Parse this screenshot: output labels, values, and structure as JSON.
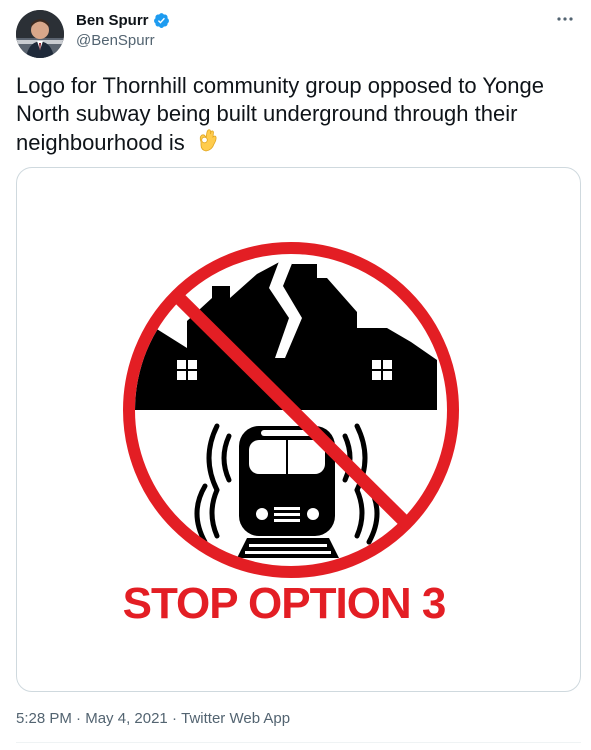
{
  "author": {
    "name": "Ben Spurr",
    "handle": "@BenSpurr",
    "verified": true,
    "verified_color": "#1d9bf0"
  },
  "menu": {
    "more_glyph": "···"
  },
  "tweet": {
    "text": "Logo for Thornhill community group opposed to Yonge North subway being built underground through their neighbourhood is ",
    "emoji": "ok-hand-emoji"
  },
  "media": {
    "logo_text": "STOP OPTION 3",
    "logo_text_color": "#e31e24",
    "prohibition_color": "#e31e24",
    "icon_color": "#000000"
  },
  "meta": {
    "time": "5:28 PM",
    "separator": " · ",
    "date": "May 4, 2021",
    "source": "Twitter Web App"
  }
}
